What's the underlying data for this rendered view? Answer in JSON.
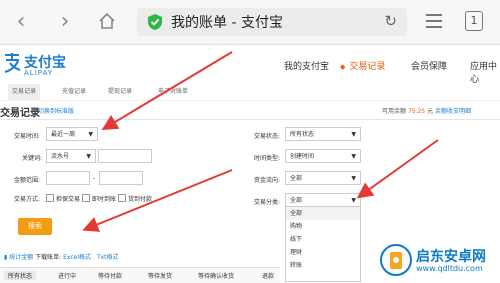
{
  "browser": {
    "title": "我的账单 - 支付宝",
    "tab_count": "1"
  },
  "header": {
    "logo_cn": "支付宝",
    "logo_en": "ALIPAY",
    "nav": [
      "我的支付宝",
      "交易记录",
      "会员保障",
      "应用中心"
    ]
  },
  "subtabs": [
    "交易记录",
    "充值记录",
    "提现记录",
    "电子对账单"
  ],
  "section": {
    "title": "交易记录",
    "switch_link": "切换到标准版",
    "balance_label": "可用余额",
    "balance_value": "75.25",
    "balance_unit": "元",
    "hide_balance": "余额收支明细"
  },
  "form": {
    "time_label": "交易时间:",
    "time_value": "最近一周",
    "keyword_label": "关键词:",
    "keyword_type": "流水号",
    "amount_label": "金额范围:",
    "amount_sep": "-",
    "method_label": "交易方式:",
    "methods": [
      "担保交易",
      "即时到账",
      "货到付款"
    ],
    "status_label": "交易状态:",
    "status_value": "所有状态",
    "timetype_label": "时间类型:",
    "timetype_value": "创建时间",
    "flow_label": "资金流向:",
    "flow_value": "全部",
    "category_label": "交易分类:",
    "category_value": "全部",
    "search_button": "搜索"
  },
  "category_options": [
    "全部",
    "购物",
    "线下",
    "理财",
    "转账"
  ],
  "download": {
    "prefix": "统计金额",
    "text": "下载账单:",
    "excel": "Excel格式",
    "txt": "Txt格式"
  },
  "bottom_tabs": [
    "所有状态",
    "进行中",
    "等待付款",
    "等待发货",
    "等待确认收货",
    "退款"
  ],
  "watermark": {
    "name": "启东安卓网",
    "url": "www.qdltdu.com"
  }
}
